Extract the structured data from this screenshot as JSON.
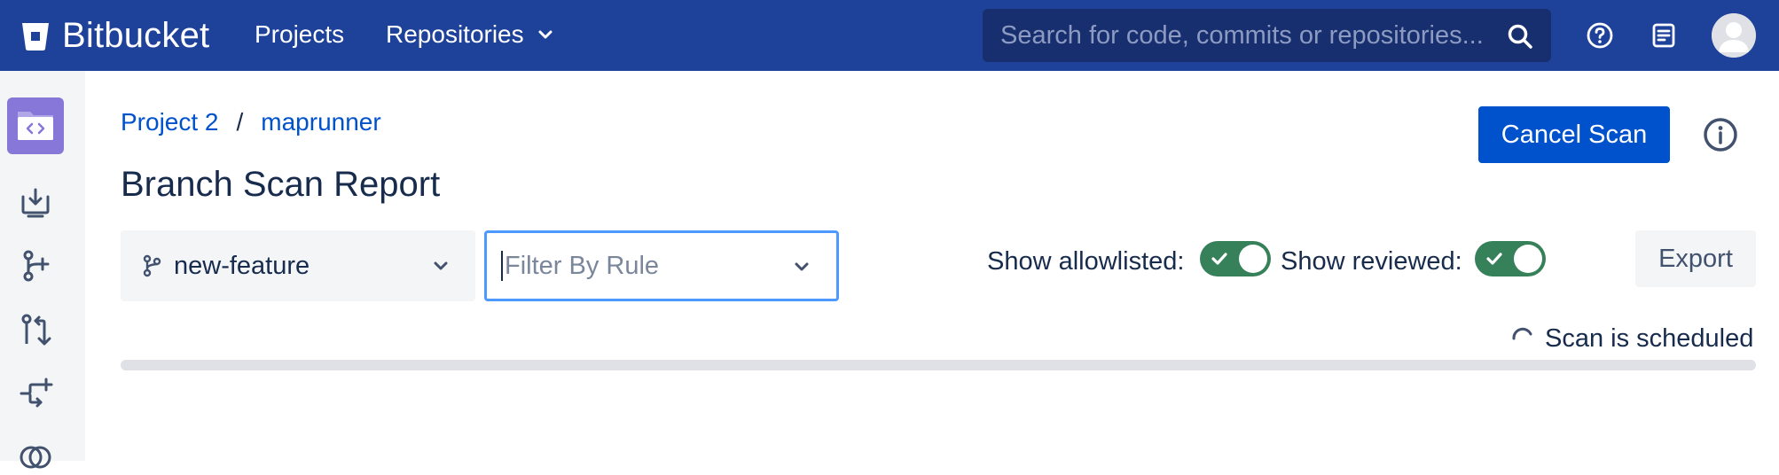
{
  "header": {
    "app_name": "Bitbucket",
    "nav": {
      "projects_label": "Projects",
      "repositories_label": "Repositories"
    },
    "search_placeholder": "Search for code, commits or repositories...",
    "icons": [
      "bitbucket-logo-icon",
      "chevron-down-icon",
      "search-icon",
      "help-icon",
      "release-notes-icon",
      "avatar"
    ]
  },
  "sidebar": {
    "items": [
      {
        "icon": "project-avatar-icon"
      },
      {
        "icon": "clone-icon"
      },
      {
        "icon": "branches-icon"
      },
      {
        "icon": "pull-requests-icon"
      },
      {
        "icon": "compare-icon"
      },
      {
        "icon": "more-icon"
      }
    ]
  },
  "breadcrumb": {
    "project": "Project 2",
    "separator": "/",
    "repository": "maprunner"
  },
  "page": {
    "title": "Branch Scan Report"
  },
  "actions": {
    "cancel_scan_label": "Cancel Scan",
    "export_label": "Export"
  },
  "filters": {
    "branch_value": "new-feature",
    "rule_placeholder": "Filter By Rule",
    "show_allowlisted_label": "Show allowlisted:",
    "show_allowlisted_on": true,
    "show_reviewed_label": "Show reviewed:",
    "show_reviewed_on": true
  },
  "status": {
    "text": "Scan is scheduled",
    "progress": 0
  },
  "colors": {
    "header_bg": "#1e4199",
    "primary_button": "#0052cc",
    "toggle_on": "#36805a",
    "link": "#0052cc",
    "focus_border": "#4c9aff",
    "sidebar_project": "#8777d9"
  }
}
